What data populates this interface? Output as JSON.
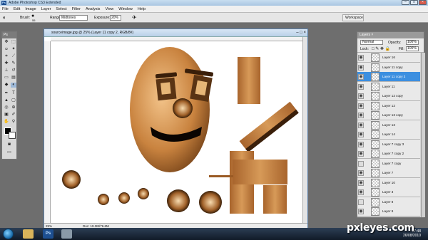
{
  "titlebar": {
    "title": "Adobe Photoshop CS3 Extended",
    "icon": "ps-app-icon"
  },
  "menubar": [
    "File",
    "Edit",
    "Image",
    "Layer",
    "Select",
    "Filter",
    "Analysis",
    "View",
    "Window",
    "Help"
  ],
  "options": {
    "brush_label": "Brush:",
    "brush_size": "55",
    "range_label": "Range:",
    "range_value": "Midtones",
    "exposure_label": "Exposure:",
    "exposure_value": "20%",
    "workspace_label": "Workspace"
  },
  "toolbox": {
    "header": "Ps"
  },
  "document": {
    "title": "sourceimage.jpg @ 25% (Layer 11 copy 2, RGB/8#)",
    "zoom": "25%",
    "doc_size": "Doc: 19.3M/76.6M"
  },
  "layers_panel": {
    "tab": "Layers ×",
    "blend_mode": "Normal",
    "opacity_label": "Opacity:",
    "opacity_value": "100%",
    "lock_label": "Lock:",
    "fill_label": "Fill:",
    "fill_value": "100%",
    "rows": [
      {
        "name": "Layer 16",
        "selected": false,
        "visible": true
      },
      {
        "name": "Layer 11 copy",
        "selected": false,
        "visible": true
      },
      {
        "name": "Layer 11 copy 2",
        "selected": true,
        "visible": true
      },
      {
        "name": "Layer 11",
        "selected": false,
        "visible": true
      },
      {
        "name": "Layer 12 copy",
        "selected": false,
        "visible": true
      },
      {
        "name": "Layer 12",
        "selected": false,
        "visible": true
      },
      {
        "name": "Layer 13 copy",
        "selected": false,
        "visible": true
      },
      {
        "name": "Layer 13",
        "selected": false,
        "visible": true
      },
      {
        "name": "Layer 14",
        "selected": false,
        "visible": true
      },
      {
        "name": "Layer 7 copy 3",
        "selected": false,
        "visible": true
      },
      {
        "name": "Layer 7 copy 2",
        "selected": false,
        "visible": true
      },
      {
        "name": "Layer 7 copy",
        "selected": false,
        "visible": false
      },
      {
        "name": "Layer 7",
        "selected": false,
        "visible": true
      },
      {
        "name": "Layer 10",
        "selected": false,
        "visible": true
      },
      {
        "name": "Layer 3",
        "selected": false,
        "visible": true
      },
      {
        "name": "Layer 8",
        "selected": false,
        "visible": false
      },
      {
        "name": "Layer 9",
        "selected": false,
        "visible": true
      }
    ]
  },
  "taskbar": {
    "time": "17:48",
    "date": "26/08/2010"
  },
  "watermark": "pxleyes.com",
  "colors": {
    "selection": "#3c8fe0",
    "wood": "#b8763e",
    "dark_wood": "#5a3414"
  }
}
